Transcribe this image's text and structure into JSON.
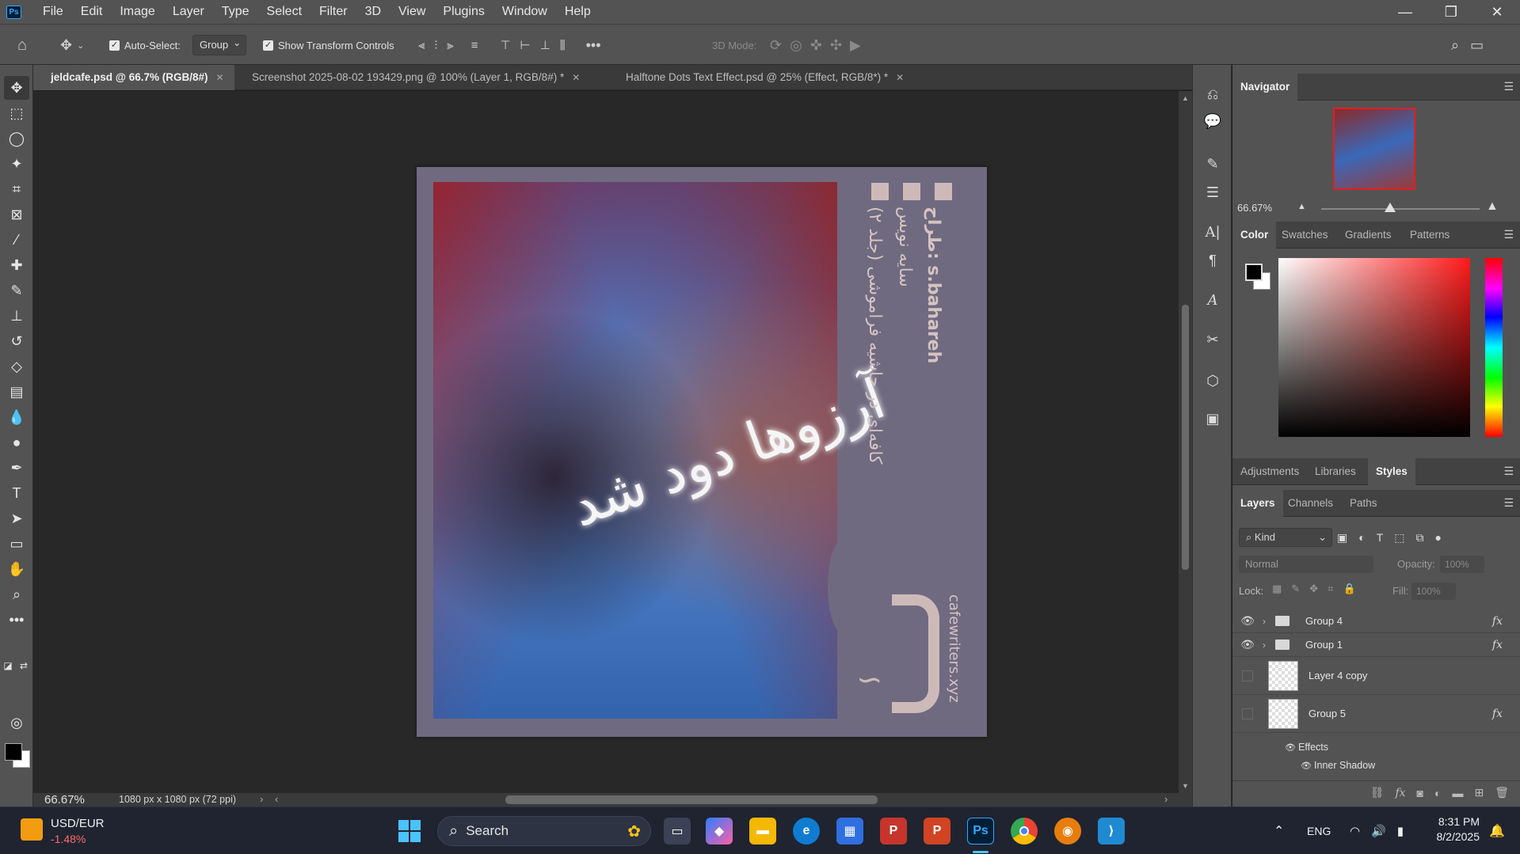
{
  "app": {
    "logo": "Ps"
  },
  "menu": [
    "File",
    "Edit",
    "Image",
    "Layer",
    "Type",
    "Select",
    "Filter",
    "3D",
    "View",
    "Plugins",
    "Window",
    "Help"
  ],
  "options": {
    "auto_select_label": "Auto-Select:",
    "auto_select_value": "Group",
    "show_transform_label": "Show Transform Controls",
    "mode_3d_label": "3D Mode:"
  },
  "tabs": [
    {
      "label": "jeldcafe.psd @ 66.7% (RGB/8#)",
      "active": true
    },
    {
      "label": "Screenshot 2025-08-02 193429.png @ 100% (Layer 1, RGB/8#) *",
      "active": false
    },
    {
      "label": "Halftone Dots Text Effect.psd @ 25% (Effect, RGB/8*) *",
      "active": false
    }
  ],
  "poster": {
    "line1": "کافه‌ای در حاشیه فراموشی (جلد ۲)",
    "line2": "سایه نویس",
    "line3": "طراح: s.bahareh",
    "site": "cafewriters.xyz",
    "calligraphy": "آرزوها دود شد"
  },
  "status": {
    "zoom": "66.67%",
    "size": "1080 px x 1080 px (72 ppi)"
  },
  "navigator": {
    "title": "Navigator",
    "zoom": "66.67%"
  },
  "color_panel": {
    "tabs": [
      "Color",
      "Swatches",
      "Gradients",
      "Patterns"
    ]
  },
  "adjust_panel": {
    "tabs": [
      "Adjustments",
      "Libraries",
      "Styles"
    ]
  },
  "layers_panel": {
    "tabs": [
      "Layers",
      "Channels",
      "Paths"
    ],
    "filter_kind": "Kind",
    "blend_mode": "Normal",
    "opacity_label": "Opacity:",
    "opacity_value": "100%",
    "lock_label": "Lock:",
    "fill_label": "Fill:",
    "fill_value": "100%",
    "layers": [
      {
        "name": "Group 4",
        "fx": "fx"
      },
      {
        "name": "Group 1",
        "fx": "fx"
      },
      {
        "name": "Layer 4 copy"
      },
      {
        "name": "Group 5",
        "fx": "fx"
      }
    ],
    "effects_label": "Effects",
    "effect_item": "Inner Shadow"
  },
  "taskbar": {
    "ticker_pair": "USD/EUR",
    "ticker_change": "-1.48%",
    "search_label": "Search",
    "lang": "ENG",
    "time": "8:31 PM",
    "date": "8/2/2025"
  }
}
